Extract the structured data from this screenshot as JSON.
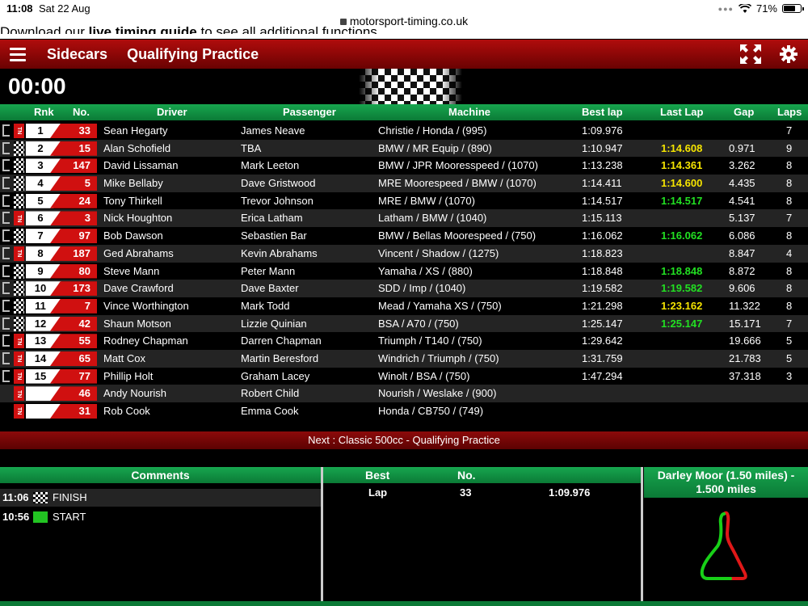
{
  "status_bar": {
    "time": "11:08",
    "date": "Sat 22 Aug",
    "battery": "71%",
    "url": "motorsport-timing.co.uk"
  },
  "cutoff_text": {
    "before": "Download our ",
    "link": "live timing guide",
    "after": " to see all additional functions"
  },
  "header": {
    "title": "Sidecars",
    "session": "Qualifying Practice"
  },
  "clock": "00:00",
  "columns": {
    "rnk": "Rnk",
    "no": "No.",
    "driver": "Driver",
    "passenger": "Passenger",
    "machine": "Machine",
    "best": "Best lap",
    "last": "Last Lap",
    "gap": "Gap",
    "laps": "Laps"
  },
  "rows": [
    {
      "rnk": "1",
      "no": "33",
      "driver": "Sean Hegarty",
      "passenger": "James Neave",
      "machine": "Christie / Honda / (995)",
      "best": "1:09.976",
      "last": "",
      "gap": "",
      "laps": "7",
      "marker": "tn",
      "last_color": "",
      "bracket": true
    },
    {
      "rnk": "2",
      "no": "15",
      "driver": "Alan Schofield",
      "passenger": "TBA",
      "machine": "BMW / MR Equip / (890)",
      "best": "1:10.947",
      "last": "1:14.608",
      "gap": "0.971",
      "laps": "9",
      "marker": "chk",
      "last_color": "yellow",
      "bracket": true
    },
    {
      "rnk": "3",
      "no": "147",
      "driver": "David Lissaman",
      "passenger": "Mark Leeton",
      "machine": "BMW / JPR Mooresspeed / (1070)",
      "best": "1:13.238",
      "last": "1:14.361",
      "gap": "3.262",
      "laps": "8",
      "marker": "chk",
      "last_color": "yellow",
      "bracket": true
    },
    {
      "rnk": "4",
      "no": "5",
      "driver": "Mike Bellaby",
      "passenger": "Dave Gristwood",
      "machine": "MRE Moorespeed / BMW / (1070)",
      "best": "1:14.411",
      "last": "1:14.600",
      "gap": "4.435",
      "laps": "8",
      "marker": "chk",
      "last_color": "yellow",
      "bracket": true
    },
    {
      "rnk": "5",
      "no": "24",
      "driver": "Tony Thirkell",
      "passenger": "Trevor Johnson",
      "machine": "MRE / BMW / (1070)",
      "best": "1:14.517",
      "last": "1:14.517",
      "gap": "4.541",
      "laps": "8",
      "marker": "chk",
      "last_color": "green",
      "bracket": true
    },
    {
      "rnk": "6",
      "no": "3",
      "driver": "Nick Houghton",
      "passenger": "Erica Latham",
      "machine": "Latham / BMW / (1040)",
      "best": "1:15.113",
      "last": "",
      "gap": "5.137",
      "laps": "7",
      "marker": "tn",
      "last_color": "",
      "bracket": true
    },
    {
      "rnk": "7",
      "no": "97",
      "driver": "Bob Dawson",
      "passenger": "Sebastien Bar",
      "machine": "BMW / Bellas Moorespeed / (750)",
      "best": "1:16.062",
      "last": "1:16.062",
      "gap": "6.086",
      "laps": "8",
      "marker": "chk",
      "last_color": "green",
      "bracket": true
    },
    {
      "rnk": "8",
      "no": "187",
      "driver": "Ged Abrahams",
      "passenger": "Kevin Abrahams",
      "machine": "Vincent / Shadow / (1275)",
      "best": "1:18.823",
      "last": "",
      "gap": "8.847",
      "laps": "4",
      "marker": "tn",
      "last_color": "",
      "bracket": true
    },
    {
      "rnk": "9",
      "no": "80",
      "driver": "Steve Mann",
      "passenger": "Peter Mann",
      "machine": "Yamaha / XS / (880)",
      "best": "1:18.848",
      "last": "1:18.848",
      "gap": "8.872",
      "laps": "8",
      "marker": "chk",
      "last_color": "green",
      "bracket": true
    },
    {
      "rnk": "10",
      "no": "173",
      "driver": "Dave Crawford",
      "passenger": "Dave Baxter",
      "machine": "SDD / Imp / (1040)",
      "best": "1:19.582",
      "last": "1:19.582",
      "gap": "9.606",
      "laps": "8",
      "marker": "chk",
      "last_color": "green",
      "bracket": true
    },
    {
      "rnk": "11",
      "no": "7",
      "driver": "Vince Worthington",
      "passenger": "Mark Todd",
      "machine": "Mead / Yamaha XS / (750)",
      "best": "1:21.298",
      "last": "1:23.162",
      "gap": "11.322",
      "laps": "8",
      "marker": "chk",
      "last_color": "yellow",
      "bracket": true
    },
    {
      "rnk": "12",
      "no": "42",
      "driver": "Shaun Motson",
      "passenger": "Lizzie Quinian",
      "machine": "BSA / A70 / (750)",
      "best": "1:25.147",
      "last": "1:25.147",
      "gap": "15.171",
      "laps": "7",
      "marker": "chk",
      "last_color": "green",
      "bracket": true
    },
    {
      "rnk": "13",
      "no": "55",
      "driver": "Rodney Chapman",
      "passenger": "Darren Chapman",
      "machine": "Triumph / T140 / (750)",
      "best": "1:29.642",
      "last": "",
      "gap": "19.666",
      "laps": "5",
      "marker": "tn",
      "last_color": "",
      "bracket": true
    },
    {
      "rnk": "14",
      "no": "65",
      "driver": "Matt Cox",
      "passenger": "Martin Beresford",
      "machine": "Windrich / Triumph / (750)",
      "best": "1:31.759",
      "last": "",
      "gap": "21.783",
      "laps": "5",
      "marker": "tn",
      "last_color": "",
      "bracket": true
    },
    {
      "rnk": "15",
      "no": "77",
      "driver": "Phillip Holt",
      "passenger": "Graham Lacey",
      "machine": "Winolt / BSA / (750)",
      "best": "1:47.294",
      "last": "",
      "gap": "37.318",
      "laps": "3",
      "marker": "tn",
      "last_color": "",
      "bracket": true
    },
    {
      "rnk": "",
      "no": "46",
      "driver": "Andy Nourish",
      "passenger": "Robert Child",
      "machine": "Nourish / Weslake / (900)",
      "best": "",
      "last": "",
      "gap": "",
      "laps": "",
      "marker": "tn",
      "last_color": "",
      "bracket": false
    },
    {
      "rnk": "",
      "no": "31",
      "driver": "Rob Cook",
      "passenger": "Emma Cook",
      "machine": "Honda / CB750 / (749)",
      "best": "",
      "last": "",
      "gap": "",
      "laps": "",
      "marker": "tn",
      "last_color": "",
      "bracket": false
    }
  ],
  "next": "Next : Classic 500cc - Qualifying Practice",
  "comments": {
    "title": "Comments",
    "items": [
      {
        "time": "11:06",
        "flag": "checkered",
        "text": "FINISH"
      },
      {
        "time": "10:56",
        "flag": "green",
        "text": "START"
      }
    ]
  },
  "best": {
    "col1": "Best",
    "col2": "No.",
    "label": "Lap",
    "no": "33",
    "time": "1:09.976"
  },
  "track": {
    "name": "Darley Moor (1.50 miles) -",
    "length": "1.500 miles"
  },
  "colors": {
    "header_red": "#b00c0c",
    "green_bar": "#17a64f",
    "yellow_lap": "#f5e400",
    "green_lap": "#22e022"
  }
}
